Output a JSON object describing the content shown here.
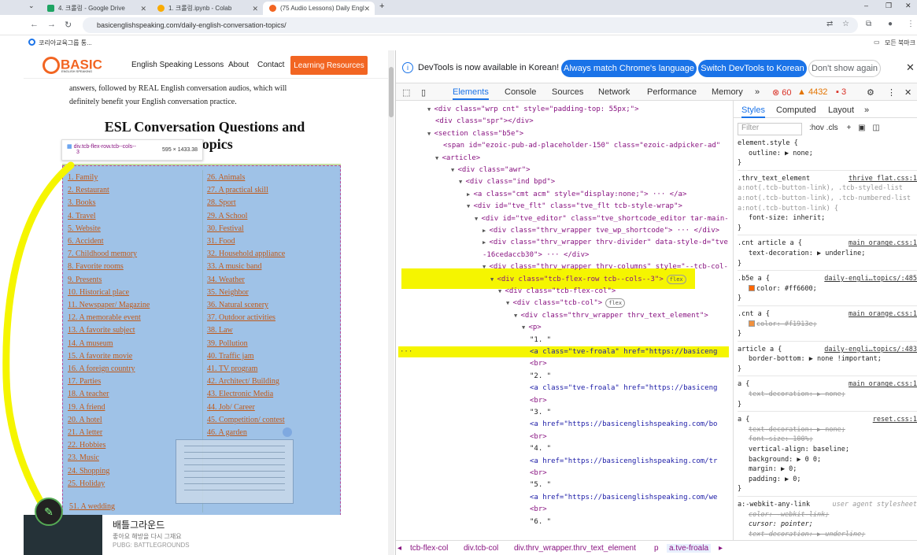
{
  "browser": {
    "tabs": [
      {
        "title": "4. 크롤링 - Google Drive"
      },
      {
        "title": "1. 크롤링.ipynb - Colab"
      },
      {
        "title": "(75 Audio Lessons) Daily Engl"
      }
    ],
    "url": "basicenglishspeaking.com/daily-english-conversation-topics/",
    "bookmarks": [
      {
        "label": "코리아교육그룹 통..."
      },
      {
        "label": "모든 북마크"
      }
    ]
  },
  "site": {
    "logo": "BASIC",
    "logo_sub": "ENGLISH SPEAKING",
    "nav": [
      {
        "label": "English Speaking Lessons"
      },
      {
        "label": "About"
      },
      {
        "label": "Contact"
      }
    ],
    "cta_label": "Learning Resources",
    "intro_lines": [
      "answers, followed by REAL English conversation audios, which will",
      "definitely benefit your English conversation practice."
    ],
    "heading_line1": "ESL Conversation Questions and",
    "heading_line2": "75 Topics",
    "inspect_tooltip": {
      "selector": "div.tcb-flex-row.tcb--cols--",
      "selector_cont": "3",
      "dims": "595 × 1433.38"
    },
    "topics_col1": [
      "1. Family",
      "2. Restaurant",
      "3. Books",
      "4. Travel",
      "5. Website",
      "6. Accident",
      "7. Childhood memory",
      "8. Favorite rooms",
      "9. Presents",
      "10. Historical place",
      "11. Newspaper/ Magazine",
      "12. A memorable event",
      "13. A favorite subject",
      "14. A museum",
      "15. A favorite movie",
      "16. A foreign country",
      "17. Parties",
      "18. A teacher",
      "19. A friend",
      "20. A hotel",
      "21. A letter",
      "22. Hobbies",
      "23. Music",
      "24. Shopping",
      "25. Holiday"
    ],
    "topics_col2": [
      "26. Animals",
      "27. A practical skill",
      "28. Sport",
      "29. A School",
      "30. Festival",
      "31. Food",
      "32. Household appliance",
      "33. A music band",
      "34. Weather",
      "35. Neighbor",
      "36. Natural scenery",
      "37. Outdoor activities",
      "38. Law",
      "39. Pollution",
      "40. Traffic jam",
      "41. TV program",
      "42. Architect/ Building",
      "43. Electronic Media",
      "44. Job/ Career",
      "45. Competition/ contest",
      "46. A garden"
    ],
    "topic_51": "51. A wedding",
    "ad": {
      "title": "배틀그라운드",
      "subtitle": "좋아요 해방을 다시 그재요",
      "source": "PUBG: BATTLEGROUNDS"
    }
  },
  "devtools": {
    "info_text": "DevTools is now available in Korean!",
    "btn_match": "Always match Chrome's language",
    "btn_switch": "Switch DevTools to Korean",
    "btn_dont": "Don't show again",
    "tabs": [
      {
        "label": "Elements"
      },
      {
        "label": "Console"
      },
      {
        "label": "Sources"
      },
      {
        "label": "Network"
      },
      {
        "label": "Performance"
      },
      {
        "label": "Memory"
      }
    ],
    "errors": "60",
    "warnings": "4432",
    "issues": "3",
    "dom_lines": [
      "<div class=\"wrp cnt\" style=\"padding-top: 55px;\">",
      "<div class=\"spr\"></div>",
      "<section class=\"b5e\">",
      "<span id=\"ezoic-pub-ad-placeholder-150\" class=\"ezoic-adpicker-ad\"",
      "<article>",
      "<div class=\"awr\">",
      "<div class=\"ind bpd\">",
      "<a class=\"cmt acm\" style=\"display:none;\"> ··· </a>",
      "<div id=\"tve_flt\" class=\"tve_flt tcb-style-wrap\">",
      "<div id=\"tve_editor\" class=\"tve_shortcode_editor tar-main-",
      "<div class=\"thrv_wrapper tve_wp_shortcode\"> ··· </div>",
      "<div class=\"thrv_wrapper thrv-divider\" data-style-d=\"tve",
      "-16cedaccb30\"> ··· </div>",
      "<div class=\"thrv_wrapper thrv-columns\" style=\"--tcb-col-",
      "<div class=\"tcb-flex-row tcb--cols--3\">",
      "<div class=\"tcb-flex-col\">",
      "<div class=\"tcb-col\">",
      "<div class=\"thrv_wrapper thrv_text_element\">",
      "<p>",
      "\"1. \"",
      "<a class=\"tve-froala\" href=\"https://basiceng",
      "<br>",
      "\"2. \"",
      "<a class=\"tve-froala\" href=\"https://basiceng",
      "<br>",
      "\"3. \"",
      "<a href=\"https://basicenglishspeaking.com/bo",
      "<br>",
      "\"4. \"",
      "<a href=\"https://basicenglishspeaking.com/tr",
      "<br>",
      "\"5. \"",
      "<a href=\"https://basicenglishspeaking.com/we",
      "<br>",
      "\"6. \""
    ],
    "flex_badge": "flex",
    "styles_tabs": [
      {
        "label": "Styles"
      },
      {
        "label": "Computed"
      },
      {
        "label": "Layout"
      }
    ],
    "filter_placeholder": "Filter",
    "filter_tools": ":hov  .cls",
    "rules": {
      "r0_sel": "element.style {",
      "r0_p": "outline: ▶ none;",
      "r1_sel": ".thrv_text_element",
      "r1_src": "thrive_flat.css:1",
      "r1_sel2": "a:not(.tcb-button-link), .tcb-styled-list a:not(.tcb-button-link), .tcb-numbered-list a:not(.tcb-button-link) {",
      "r1_p": "font-size: inherit;",
      "r2_sel": ".cnt article a {",
      "r2_src": "main_orange.css:1",
      "r2_p": "text-decoration: ▶ underline;",
      "r3_sel": ".b5e a {",
      "r3_src": "daily-engli…topics/:485",
      "r3_p": "color: #ff6600;",
      "r4_sel": ".cnt a {",
      "r4_src": "main_orange.css:1",
      "r4_p": "color: #f1913e;",
      "r5_sel": "article a {",
      "r5_src": "daily-engli…topics/:483",
      "r5_p": "border-bottom: ▶ none !important;",
      "r6_sel": "a {",
      "r6_src": "main_orange.css:1",
      "r6_p": "text-decoration: ▶ none;",
      "r7_sel": "a {",
      "r7_src": "reset.css:1",
      "r7_p1": "text-decoration: ▶ none;",
      "r7_p2": "font-size: 100%;",
      "r7_p3": "vertical-align: baseline;",
      "r7_p4": "background: ▶ 0 0;",
      "r7_p5": "margin: ▶ 0;",
      "r7_p6": "padding: ▶ 0;",
      "r8_sel": "a:-webkit-any-link",
      "r8_src": "user agent stylesheet",
      "r8_p1": "color: -webkit-link;",
      "r8_p2": "cursor: pointer;",
      "r8_p3": "text-decoration: ▶ underline;"
    },
    "breadcrumbs": [
      {
        "label": "tcb-flex-col"
      },
      {
        "label": "div.tcb-col"
      },
      {
        "label": "div.thrv_wrapper.thrv_text_element"
      },
      {
        "label": "p"
      },
      {
        "label": "a.tve-froala"
      }
    ]
  },
  "colors": {
    "accent": "#1a73e8",
    "brand": "#f26522",
    "highlight": "#f5f500",
    "link_orange": "#ff6600",
    "link_muted": "#f1913e"
  }
}
